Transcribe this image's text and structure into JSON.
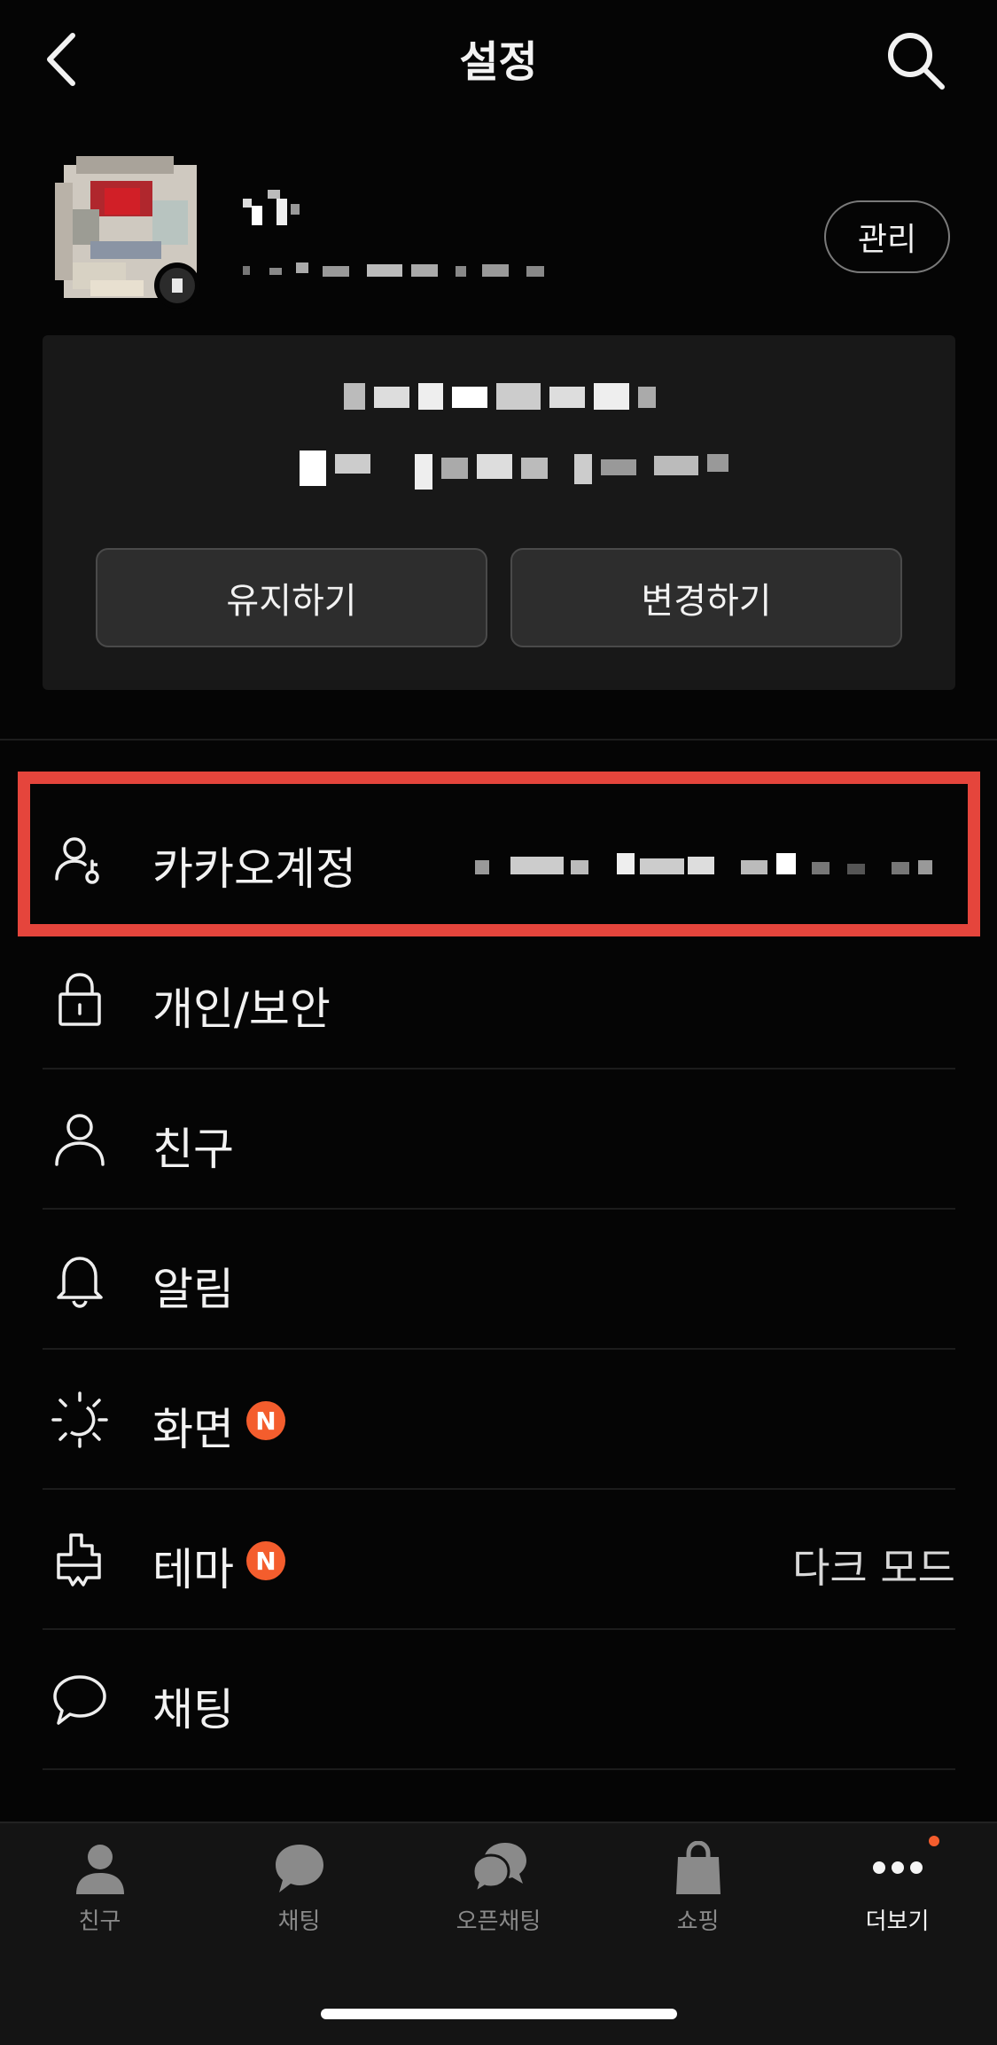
{
  "header": {
    "title": "설정"
  },
  "profile": {
    "manage_label": "관리"
  },
  "notice_card": {
    "keep_label": "유지하기",
    "change_label": "변경하기"
  },
  "menu": {
    "items": [
      {
        "label": "카카오계정",
        "icon": "account-icon"
      },
      {
        "label": "개인/보안",
        "icon": "lock-icon"
      },
      {
        "label": "친구",
        "icon": "person-icon"
      },
      {
        "label": "알림",
        "icon": "bell-icon"
      },
      {
        "label": "화면",
        "icon": "brightness-icon",
        "badge": "N"
      },
      {
        "label": "테마",
        "icon": "paint-icon",
        "badge": "N",
        "value": "다크 모드"
      },
      {
        "label": "채팅",
        "icon": "chat-bubble-icon"
      }
    ]
  },
  "tabbar": {
    "items": [
      {
        "label": "친구",
        "icon": "person-icon"
      },
      {
        "label": "채팅",
        "icon": "chat-icon"
      },
      {
        "label": "오픈채팅",
        "icon": "open-chat-icon"
      },
      {
        "label": "쇼핑",
        "icon": "shopping-bag-icon"
      },
      {
        "label": "더보기",
        "icon": "more-icon"
      }
    ]
  },
  "colors": {
    "background": "#050505",
    "accent_badge": "#f45d2d",
    "highlight": "#e5453c"
  }
}
